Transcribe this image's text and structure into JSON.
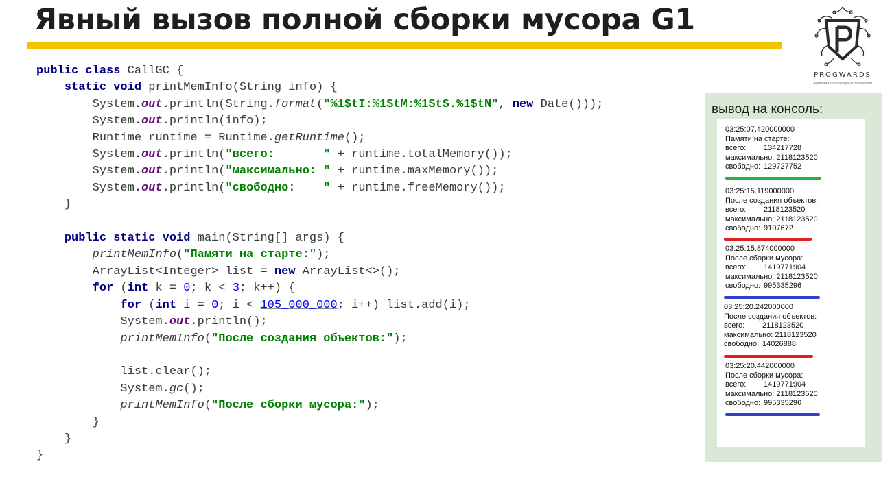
{
  "title": "Явный вызов полной сборки мусора G1",
  "logo": {
    "text": "PROGWARDS",
    "subtitle": "Академия компьютерных технологий"
  },
  "colors": {
    "accent": "#f2c400",
    "green": "#22b04a",
    "red": "#e02020",
    "blue": "#3040c8"
  },
  "code": {
    "l1a": "public class",
    "l1b": " CallGC {",
    "l2a": "static void",
    "l2b": " printMemInfo(String info) {",
    "l3a": "System.",
    "l3b": "out",
    "l3c": ".println(String.",
    "l3d": "format",
    "l3e": "(",
    "l3f": "\"%1$tI:%1$tM:%1$tS.%1$tN\"",
    "l3g": ", ",
    "l3h": "new",
    "l3i": " Date()));",
    "l4a": "System.",
    "l4b": "out",
    "l4c": ".println(info);",
    "l5a": "Runtime runtime = Runtime.",
    "l5b": "getRuntime",
    "l5c": "();",
    "l6a": "System.",
    "l6b": "out",
    "l6c": ".println(",
    "l6d": "\"всего:       \"",
    "l6e": " + runtime.totalMemory());",
    "l7a": "System.",
    "l7b": "out",
    "l7c": ".println(",
    "l7d": "\"максимально: \"",
    "l7e": " + runtime.maxMemory());",
    "l8a": "System.",
    "l8b": "out",
    "l8c": ".println(",
    "l8d": "\"свободно:    \"",
    "l8e": " + runtime.freeMemory());",
    "l9": "}",
    "l11a": "public static void",
    "l11b": " main(String[] args) {",
    "l12a": "printMemInfo",
    "l12b": "(",
    "l12c": "\"Памяти на старте:\"",
    "l12d": ");",
    "l13a": "ArrayList<Integer> list = ",
    "l13b": "new",
    "l13c": " ArrayList<>();",
    "l14a": "for",
    "l14b": " (",
    "l14c": "int",
    "l14d": " k = ",
    "l14e": "0",
    "l14f": "; k < ",
    "l14g": "3",
    "l14h": "; k++) {",
    "l15a": "for",
    "l15b": " (",
    "l15c": "int",
    "l15d": " i = ",
    "l15e": "0",
    "l15f": "; i < ",
    "l15g": "105_000_000",
    "l15h": "; i++) list.add(i);",
    "l16a": "System.",
    "l16b": "out",
    "l16c": ".println();",
    "l17a": "printMemInfo",
    "l17b": "(",
    "l17c": "\"После создания объектов:\"",
    "l17d": ");",
    "l19": "list.clear();",
    "l20a": "System.",
    "l20b": "gc",
    "l20c": "();",
    "l21a": "printMemInfo",
    "l21b": "(",
    "l21c": "\"После сборки мусора:\"",
    "l21d": ");",
    "l22": "}",
    "l23": "}",
    "l24": "}"
  },
  "console": {
    "title": "вывод на консоль:",
    "blocks": [
      {
        "time": "03:25:07.420000000",
        "header": "Памяти на старте:",
        "total_label": "всего:",
        "total": "134217728",
        "max_label": "максимально:",
        "max": "2118123520",
        "free_label": "свободно:",
        "free": "129727752"
      },
      {
        "time": "03:25:15.119000000",
        "header": "После создания объектов:",
        "total_label": "всего:",
        "total": "2118123520",
        "max_label": "максимально:",
        "max": "2118123520",
        "free_label": "свободно:",
        "free": "9107672"
      },
      {
        "time": "03:25:15.874000000",
        "header": "После сборки мусора:",
        "total_label": "всего:",
        "total": "1419771904",
        "max_label": "максимально:",
        "max": "2118123520",
        "free_label": "свободно:",
        "free": "995335296"
      },
      {
        "time": "03:25:20.242000000",
        "header": "После создания объектов:",
        "total_label": "всего:",
        "total": "2118123520",
        "max_label": "максимально:",
        "max": "2118123520",
        "free_label": "свободно:",
        "free": "14026888"
      },
      {
        "time": "03:25:20.442000000",
        "header": "После сборки мусора:",
        "total_label": "всего:",
        "total": "1419771904",
        "max_label": "максимально:",
        "max": "2118123520",
        "free_label": "свободно:",
        "free": "995335296"
      }
    ]
  }
}
